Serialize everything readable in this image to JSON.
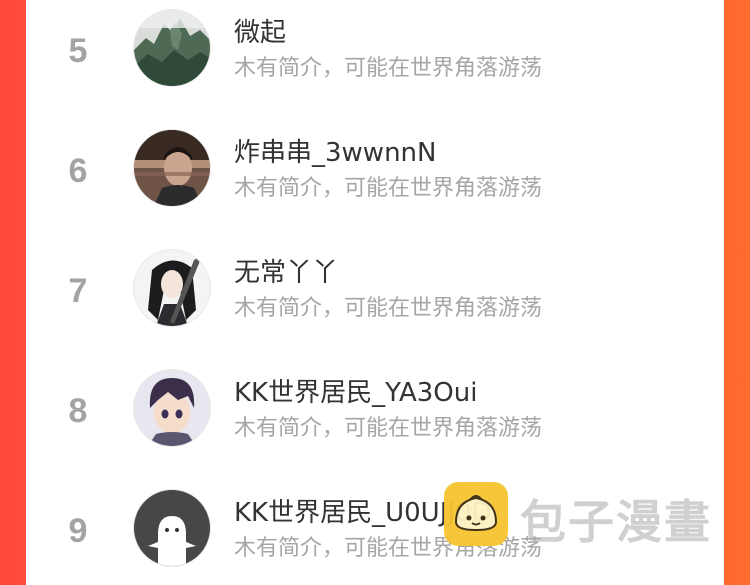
{
  "ranking": [
    {
      "rank": "5",
      "name": "微起",
      "bio": "木有简介，可能在世界角落游荡",
      "avatar": "mountain-landscape-avatar"
    },
    {
      "rank": "6",
      "name": "炸串串_3wwnnN",
      "bio": "木有简介，可能在世界角落游荡",
      "avatar": "man-portrait-avatar"
    },
    {
      "rank": "7",
      "name": "无常丫丫",
      "bio": "木有简介，可能在世界角落游荡",
      "avatar": "anime-swordsman-avatar"
    },
    {
      "rank": "8",
      "name": "KK世界居民_YA3Oui",
      "bio": "木有简介，可能在世界角落游荡",
      "avatar": "anime-boy-avatar"
    },
    {
      "rank": "9",
      "name": "KK世界居民_U0UJJ0D",
      "bio": "木有简介，可能在世界角落游荡",
      "avatar": "default-ghost-avatar"
    }
  ],
  "watermark": {
    "text": "包子漫畫",
    "logo": "bun-logo-icon"
  },
  "colors": {
    "rank": "#a3a3a3",
    "name": "#333333",
    "bio": "#a6a6a6",
    "side_gradient_start": "#ff4a3a",
    "side_gradient_end": "#ff6a2e"
  }
}
